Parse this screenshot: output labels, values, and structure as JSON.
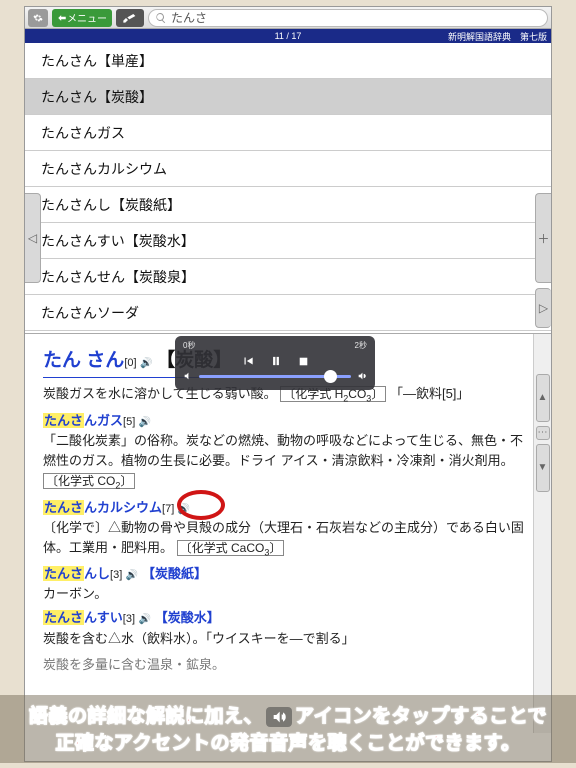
{
  "toolbar": {
    "menu_label": "メニュー",
    "search_value": "たんさ"
  },
  "statusbar": {
    "counter": "11 / 17",
    "source": "新明解国語辞典　第七版"
  },
  "list": {
    "items": [
      {
        "label": "たんさん【単産】"
      },
      {
        "label": "たんさん【炭酸】",
        "selected": true
      },
      {
        "label": "たんさんガス"
      },
      {
        "label": "たんさんカルシウム"
      },
      {
        "label": "たんさんし【炭酸紙】"
      },
      {
        "label": "たんさんすい【炭酸水】"
      },
      {
        "label": "たんさんせん【炭酸泉】"
      },
      {
        "label": "たんさんソーダ"
      }
    ]
  },
  "detail": {
    "hw_reading_a": "たん",
    "hw_reading_b": "さん",
    "hw_pitch": "[0]",
    "hw_kanji": "【炭酸】",
    "body1_a": "炭酸ガスを水に溶かして生じる弱い酸。",
    "body1_chem": "化学式 H",
    "body1_sub2": "2",
    "body1_co": "CO",
    "body1_sub3": "3",
    "body1_b": "「―飲料[5]」",
    "t1_hl": "たんさ",
    "t1_rest": "んガス",
    "t1_pitch": "[5]",
    "t1_body": "「二酸化炭素」の俗称。炭などの燃焼、動物の呼吸などによって生じる、無色・不燃性のガス。植物の生長に必要。ドライ アイス・清涼飲料・冷凍剤・消火剤用。",
    "t1_chem": "化学式 CO",
    "t1_sub": "2",
    "t2_hl": "たんさ",
    "t2_rest": "んカルシウム",
    "t2_pitch": "[7]",
    "t2_body": "〔化学で〕△動物の骨や貝殻の成分（大理石・石灰岩などの主成分）である白い固体。工業用・肥料用。",
    "t2_chem": "化学式 CaCO",
    "t2_sub": "3",
    "t3_hl": "たんさ",
    "t3_rest": "んし",
    "t3_pitch": "[3]",
    "t3_kanji": "【炭酸紙】",
    "t3_body": "カーボン。",
    "t4_hl": "たんさ",
    "t4_rest": "んすい",
    "t4_pitch": "[3]",
    "t4_kanji": "【炭酸水】",
    "t4_body": "炭酸を含む△水（飲料水）。「ウイスキーを―で割る」",
    "t5_body": "炭酸を多量に含む温泉・鉱泉。"
  },
  "audio": {
    "t0": "0秒",
    "t1": "2秒"
  },
  "caption": {
    "line1a": "語義の詳細な解説に加え、",
    "line1b": "アイコンをタップすることで",
    "line2": "正確なアクセントの発音音声を聴くことができます。"
  }
}
